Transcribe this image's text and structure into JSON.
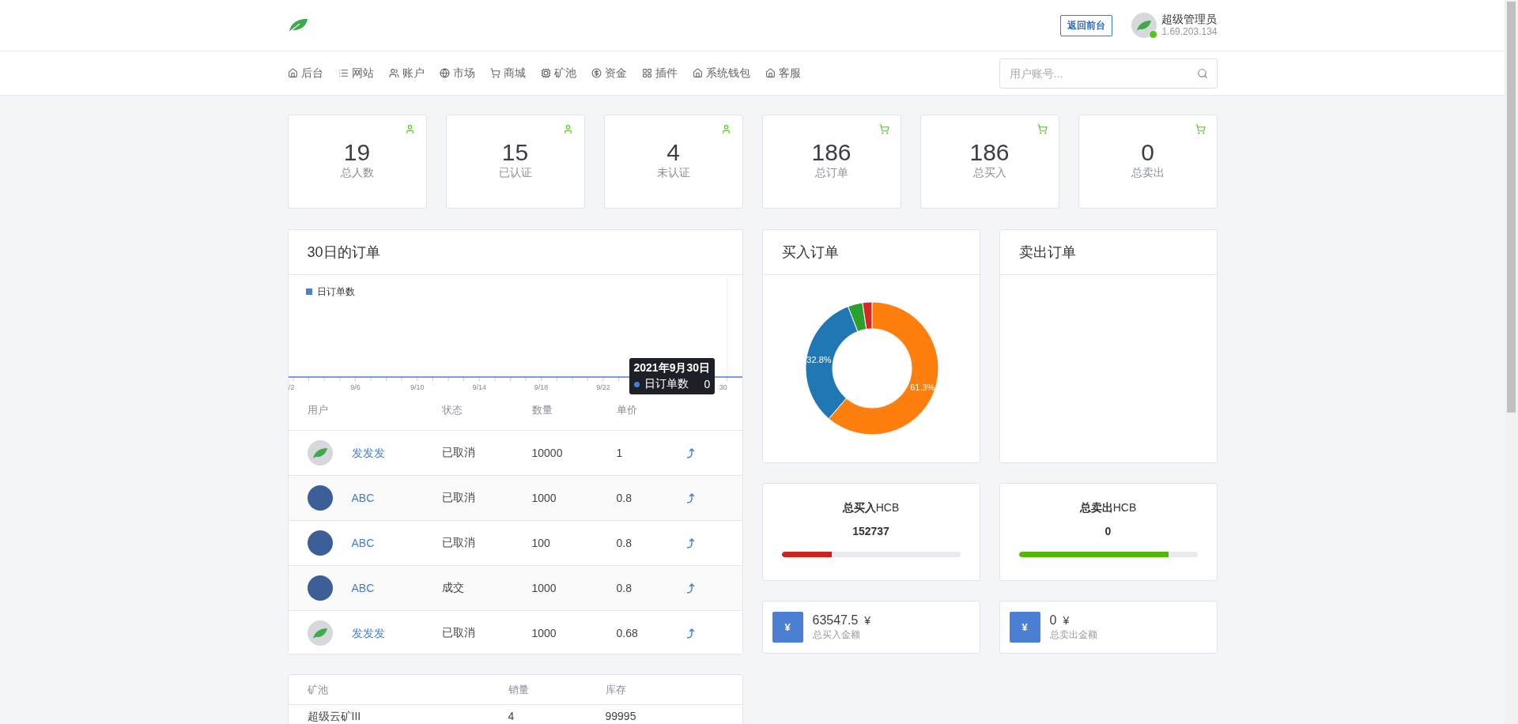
{
  "header": {
    "button": "返回前台",
    "user": {
      "name": "超级管理员",
      "ip": "1.69.203.134",
      "online": true
    }
  },
  "nav": [
    {
      "label": "后台",
      "kind": "home"
    },
    {
      "label": "网站",
      "kind": "list"
    },
    {
      "label": "账户",
      "kind": "users"
    },
    {
      "label": "市场",
      "kind": "globe"
    },
    {
      "label": "商城",
      "kind": "cart"
    },
    {
      "label": "矿池",
      "kind": "chip"
    },
    {
      "label": "资金",
      "kind": "coin"
    },
    {
      "label": "插件",
      "kind": "grid"
    },
    {
      "label": "系统钱包",
      "kind": "home"
    },
    {
      "label": "客服",
      "kind": "home"
    }
  ],
  "search": {
    "placeholder": "用户账号..."
  },
  "stats": [
    {
      "value": "19",
      "label": "总人数",
      "kind": "user"
    },
    {
      "value": "15",
      "label": "已认证",
      "kind": "user"
    },
    {
      "value": "4",
      "label": "未认证",
      "kind": "user"
    },
    {
      "value": "186",
      "label": "总订单",
      "kind": "cart"
    },
    {
      "value": "186",
      "label": "总买入",
      "kind": "cart"
    },
    {
      "value": "0",
      "label": "总卖出",
      "kind": "cart"
    }
  ],
  "daily_orders": {
    "title": "30日的订单",
    "legend": "日订单数",
    "axis_labels": [
      "/2",
      "9/6",
      "9/10",
      "9/14",
      "9/18",
      "9/22",
      "30"
    ],
    "tooltip": {
      "title": "2021年9月30日",
      "label": "日订单数",
      "value": "0"
    },
    "table": {
      "columns": [
        "用户",
        "状态",
        "数量",
        "单价"
      ],
      "rows": [
        {
          "kind": "leaf",
          "user": "发发发",
          "status": "已取消",
          "quantity": "10000",
          "price": "1"
        },
        {
          "kind": "photo",
          "user": "ABC",
          "status": "已取消",
          "quantity": "1000",
          "price": "0.8"
        },
        {
          "kind": "photo",
          "user": "ABC",
          "status": "已取消",
          "quantity": "100",
          "price": "0.8"
        },
        {
          "kind": "photo",
          "user": "ABC",
          "status": "成交",
          "quantity": "1000",
          "price": "0.8"
        },
        {
          "kind": "leaf",
          "user": "发发发",
          "status": "已取消",
          "quantity": "1000",
          "price": "0.68"
        }
      ]
    }
  },
  "buy_orders": {
    "title": "买入订单",
    "chart_data": {
      "type": "donut",
      "values": [
        61.3,
        32.8,
        3.6,
        2.3
      ],
      "value_labels": [
        "61.3%",
        "32.8%",
        null,
        null
      ]
    }
  },
  "sell_orders": {
    "title": "卖出订单"
  },
  "totals": [
    {
      "title": "**总买入**HCB",
      "value": "152737",
      "level": 0.28,
      "color": "#d0211c"
    },
    {
      "title": "**总卖出**HCB",
      "value": "0",
      "level": 0.84,
      "color": "#52b80a"
    }
  ],
  "amounts": [
    {
      "symbol": "¥",
      "value": "63547.5",
      "currency": "¥",
      "label": "总买入金额"
    },
    {
      "symbol": "¥",
      "value": "0",
      "currency": "¥",
      "label": "总卖出金额"
    }
  ],
  "pool_table": {
    "columns": [
      "矿池",
      "销量",
      "库存"
    ],
    "rows": [
      [
        "超级云矿III",
        "4",
        "99995"
      ]
    ]
  }
}
